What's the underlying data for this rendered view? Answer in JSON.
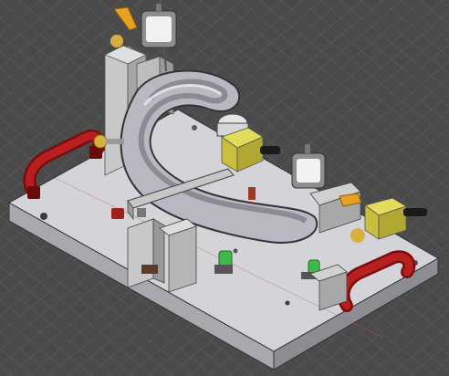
{
  "viewport": {
    "label": "",
    "background": "#4a4a4a",
    "grid_color": "#5c5c5c"
  },
  "model": {
    "colors": {
      "base_plate": "#d3d3d8",
      "base_plate_side": "#a8a8ae",
      "handle": "#b01818",
      "support_block": "#d0d0d0",
      "tube_body": "#c4c4cc",
      "tube_shadow": "#8a8a94",
      "clamp_arm": "#c9c9c9",
      "gauge_face": "#f2f2f2",
      "gauge_body": "#9a9a9a",
      "lever": "#e8a020",
      "yellow_block": "#d8d040",
      "green_fitting": "#3fb84a",
      "knob": "#1a1a1a"
    },
    "icons": [
      "dial-indicator-icon",
      "clamp-lever-icon",
      "handle-icon",
      "locating-pin-icon"
    ]
  }
}
